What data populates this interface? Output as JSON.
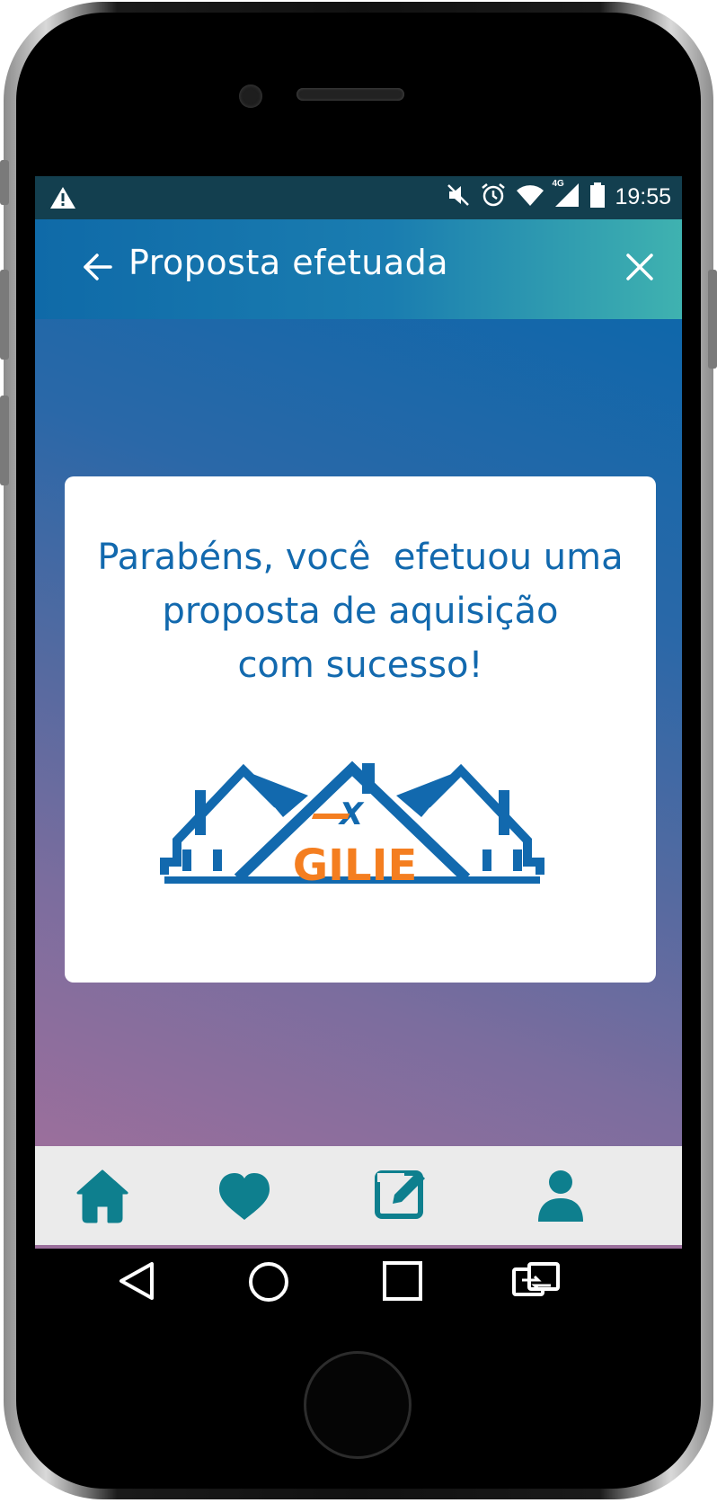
{
  "status_bar": {
    "time": "19:55",
    "network_label": "4G",
    "icons": [
      "warning-icon",
      "mute-icon",
      "alarm-icon",
      "wifi-icon",
      "signal-icon",
      "battery-icon"
    ]
  },
  "app_bar": {
    "title": "Proposta efetuada",
    "back_icon": "arrow-left-icon",
    "close_icon": "close-icon",
    "color_start": "#0f6aa8",
    "color_end": "#3fb2b0"
  },
  "card": {
    "message_lines": [
      "Parabéns, você  efetuou uma",
      "proposta de aquisição",
      "com sucesso!"
    ],
    "logo_text": "GILIE",
    "logo_mark": "X",
    "text_color": "#1269ae",
    "logo_blue": "#1269ae",
    "logo_orange": "#f47e20"
  },
  "bottom_nav": {
    "items": [
      {
        "icon": "home-icon"
      },
      {
        "icon": "heart-icon"
      },
      {
        "icon": "edit-icon"
      },
      {
        "icon": "user-icon"
      }
    ],
    "icon_color": "#0e7f8e"
  },
  "android_nav": {
    "items": [
      "back-triangle-icon",
      "home-circle-icon",
      "recents-square-icon",
      "switch-app-icon"
    ]
  }
}
